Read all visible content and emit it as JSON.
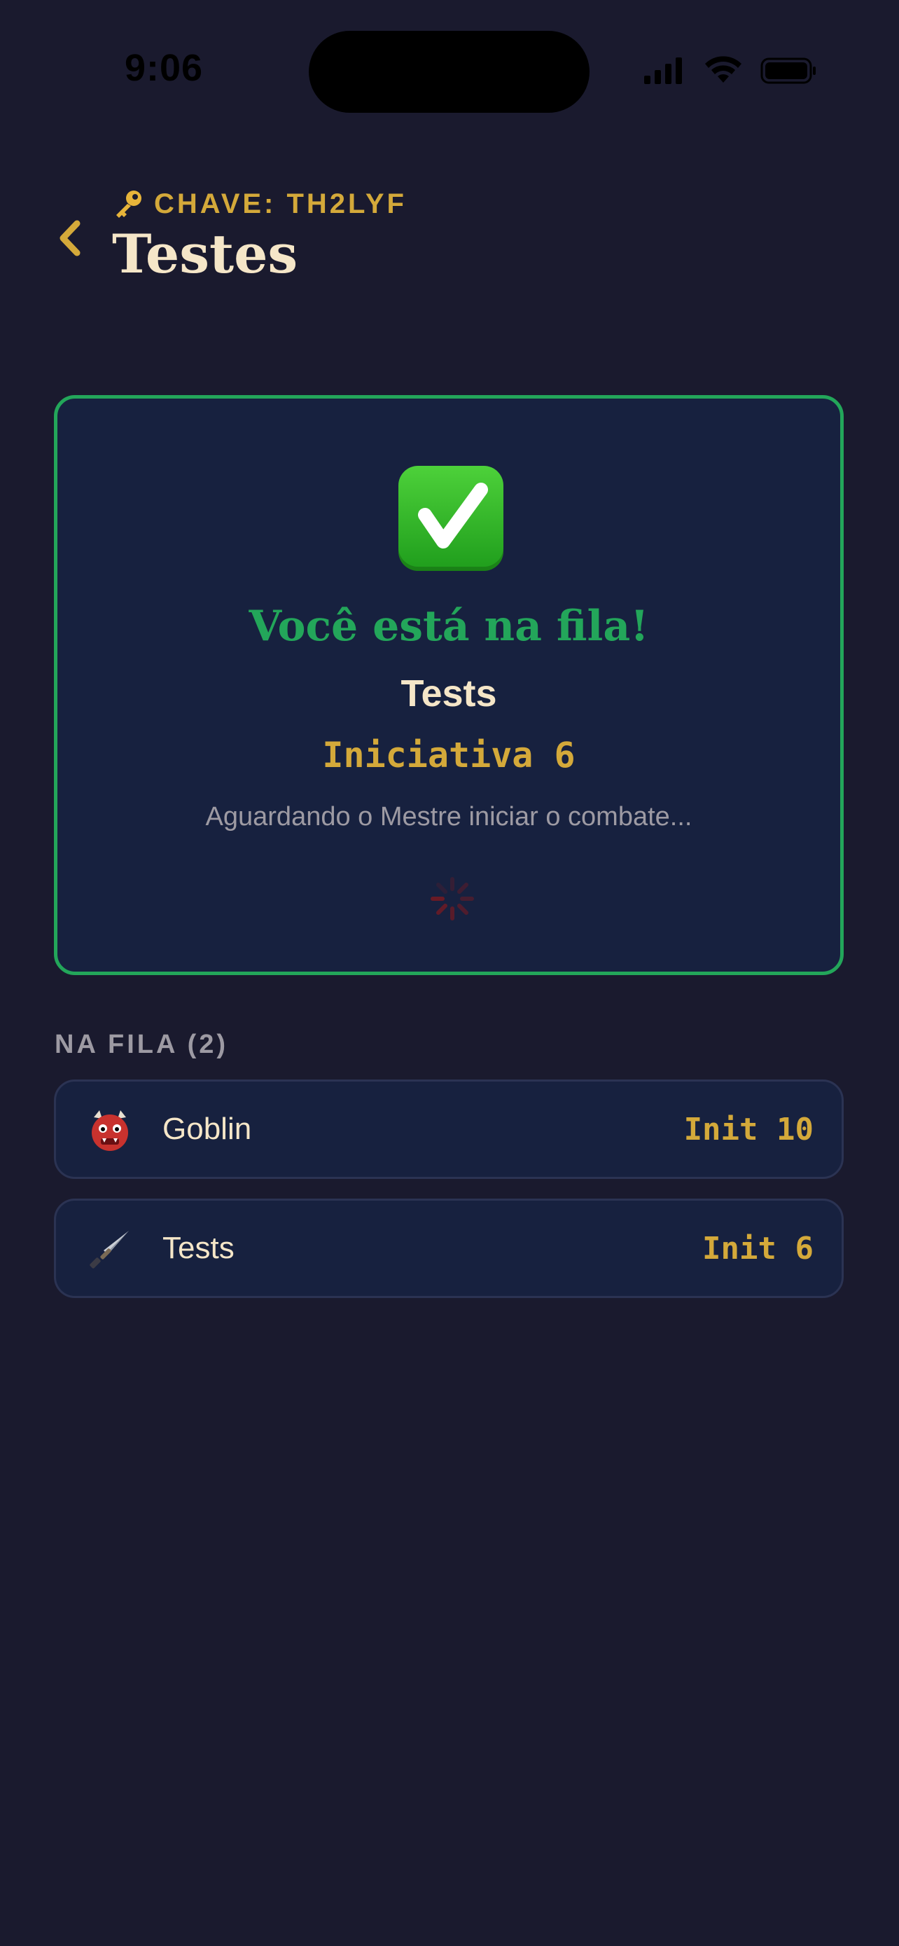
{
  "status_bar": {
    "time": "9:06"
  },
  "header": {
    "key_label": "CHAVE: TH2LYF",
    "key_icon": "key-icon",
    "title": "Testes",
    "back_icon": "chevron-left-icon"
  },
  "confirmation": {
    "icon": "check-mark-icon",
    "title": "Você está na fila!",
    "name": "Tests",
    "initiative": "Iniciativa 6",
    "status": "Aguardando o Mestre iniciar o combate..."
  },
  "queue": {
    "label": "NA FILA (2)",
    "items": [
      {
        "icon": "ogre-icon",
        "name": "Goblin",
        "initiative": "Init 10"
      },
      {
        "icon": "dagger-icon",
        "name": "Tests",
        "initiative": "Init 6"
      }
    ]
  },
  "colors": {
    "background": "#1a1a2e",
    "card": "#17213f",
    "accent_gold": "#d4a93a",
    "success_green": "#23a65a",
    "text_cream": "#f5e6c8",
    "text_muted": "#9d9aa3"
  }
}
